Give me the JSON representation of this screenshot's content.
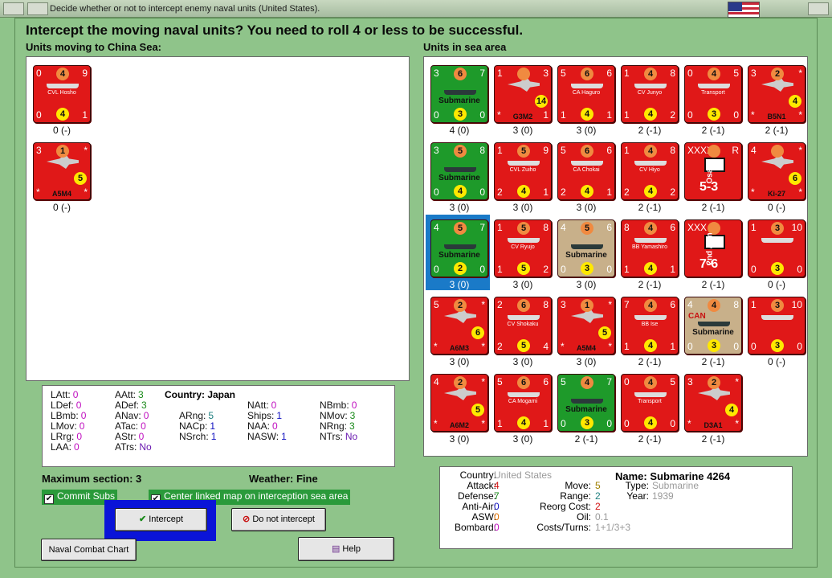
{
  "window": {
    "title": "Decide whether or not to intercept enemy naval units (United States)."
  },
  "header": {
    "title": "Intercept the moving naval units?  You need to roll 4 or less to be successful."
  },
  "left_panel": {
    "label": "Units moving to China Sea:",
    "units": [
      {
        "name": "CVL Hosho",
        "tl": "0",
        "tr": "9",
        "bl": "0",
        "br": "1",
        "top_val": "4",
        "bot_val": "4",
        "status": "0 (-)",
        "color": "red",
        "kind": "ship"
      },
      {
        "name": "A5M4",
        "tl": "3",
        "tr": "*",
        "bl": "*",
        "br": "*",
        "top_val": "1",
        "bot_val": "5",
        "status": "0 (-)",
        "color": "red",
        "kind": "plane"
      }
    ]
  },
  "right_panel": {
    "label": "Units in sea area",
    "units": [
      {
        "name": "Submarine",
        "tl": "3",
        "tr": "7",
        "bl": "0",
        "br": "0",
        "top_val": "6",
        "bot_val": "3",
        "status": "4 (0)",
        "color": "green",
        "kind": "sub"
      },
      {
        "name": "G3M2",
        "tl": "1",
        "tr": "3",
        "bl": "*",
        "br": "1",
        "top_val": "",
        "bot_val": "14",
        "status": "3 (0)",
        "color": "red",
        "kind": "plane"
      },
      {
        "name": "CA Haguro",
        "tl": "5",
        "tr": "6",
        "bl": "1",
        "br": "1",
        "top_val": "6",
        "bot_val": "4",
        "status": "3 (0)",
        "color": "red",
        "kind": "ship"
      },
      {
        "name": "CV Junyo",
        "tl": "1",
        "tr": "8",
        "bl": "1",
        "br": "2",
        "top_val": "4",
        "bot_val": "4",
        "status": "2 (-1)",
        "color": "red",
        "kind": "ship"
      },
      {
        "name": "Transport",
        "tl": "0",
        "tr": "5",
        "bl": "0",
        "br": "0",
        "top_val": "4",
        "bot_val": "3",
        "status": "2 (-1)",
        "color": "red",
        "kind": "ship"
      },
      {
        "name": "B5N1",
        "tl": "3",
        "tr": "*",
        "bl": "*",
        "br": "*",
        "top_val": "2",
        "bot_val": "4",
        "status": "2 (-1)",
        "color": "red",
        "kind": "plane"
      },
      {
        "name": "Submarine",
        "tl": "3",
        "tr": "8",
        "bl": "0",
        "br": "0",
        "top_val": "5",
        "bot_val": "4",
        "status": "3 (0)",
        "color": "green",
        "kind": "sub"
      },
      {
        "name": "CVL Zuiho",
        "tl": "1",
        "tr": "9",
        "bl": "2",
        "br": "1",
        "top_val": "5",
        "bot_val": "4",
        "status": "3 (0)",
        "color": "red",
        "kind": "ship"
      },
      {
        "name": "CA Chokai",
        "tl": "5",
        "tr": "6",
        "bl": "2",
        "br": "1",
        "top_val": "6",
        "bot_val": "4",
        "status": "3 (0)",
        "color": "red",
        "kind": "ship"
      },
      {
        "name": "CV Hiyo",
        "tl": "1",
        "tr": "8",
        "bl": "2",
        "br": "2",
        "top_val": "4",
        "bot_val": "4",
        "status": "2 (-1)",
        "color": "red",
        "kind": "ship"
      },
      {
        "name": "Osaka",
        "tl": "XXXX",
        "tr": "R",
        "bl": "",
        "br": "",
        "top_val": "",
        "bot_val": "5-3",
        "status": "2 (-1)",
        "color": "red",
        "kind": "land"
      },
      {
        "name": "Ki-27",
        "tl": "4",
        "tr": "*",
        "bl": "*",
        "br": "*",
        "top_val": "",
        "bot_val": "6",
        "status": "0 (-)",
        "color": "red",
        "kind": "plane"
      },
      {
        "name": "Submarine",
        "tl": "4",
        "tr": "7",
        "bl": "0",
        "br": "0",
        "top_val": "5",
        "bot_val": "2",
        "status": "3 (0)",
        "color": "green",
        "kind": "sub"
      },
      {
        "name": "CV Ryujo",
        "tl": "1",
        "tr": "8",
        "bl": "1",
        "br": "2",
        "top_val": "5",
        "bot_val": "5",
        "status": "3 (0)",
        "color": "red",
        "kind": "ship"
      },
      {
        "name": "Submarine",
        "tl": "4",
        "tr": "6",
        "bl": "0",
        "br": "0",
        "top_val": "5",
        "bot_val": "3",
        "status": "3 (0)",
        "color": "tan",
        "kind": "sub"
      },
      {
        "name": "BB Yamashiro",
        "tl": "8",
        "tr": "6",
        "bl": "1",
        "br": "1",
        "top_val": "4",
        "bot_val": "4",
        "status": "2 (-1)",
        "color": "red",
        "kind": "ship"
      },
      {
        "name": "2nd Arm",
        "tl": "XXX",
        "tr": "",
        "bl": "",
        "br": "",
        "top_val": "",
        "bot_val": "7-6",
        "status": "2 (-1)",
        "color": "red",
        "kind": "land"
      },
      {
        "name": "",
        "tl": "1",
        "tr": "10",
        "bl": "0",
        "br": "0",
        "top_val": "3",
        "bot_val": "3",
        "status": "0 (-)",
        "color": "red",
        "kind": "ship"
      },
      {
        "name": "A6M3",
        "tl": "5",
        "tr": "*",
        "bl": "*",
        "br": "*",
        "top_val": "2",
        "bot_val": "6",
        "status": "3 (0)",
        "color": "red",
        "kind": "plane"
      },
      {
        "name": "CV Shokaku",
        "tl": "2",
        "tr": "8",
        "bl": "2",
        "br": "4",
        "top_val": "6",
        "bot_val": "5",
        "status": "3 (0)",
        "color": "red",
        "kind": "ship"
      },
      {
        "name": "A5M4",
        "tl": "3",
        "tr": "*",
        "bl": "*",
        "br": "*",
        "top_val": "1",
        "bot_val": "5",
        "status": "3 (0)",
        "color": "red",
        "kind": "plane"
      },
      {
        "name": "BB Ise",
        "tl": "7",
        "tr": "6",
        "bl": "1",
        "br": "1",
        "top_val": "4",
        "bot_val": "4",
        "status": "2 (-1)",
        "color": "red",
        "kind": "ship"
      },
      {
        "name": "Submarine",
        "tl": "4",
        "tr": "8",
        "bl": "0",
        "br": "0",
        "top_val": "4",
        "bot_val": "3",
        "status": "2 (-1)",
        "color": "tan",
        "kind": "sub",
        "tag": "CAN"
      },
      {
        "name": "",
        "tl": "1",
        "tr": "10",
        "bl": "0",
        "br": "0",
        "top_val": "3",
        "bot_val": "3",
        "status": "0 (-)",
        "color": "red",
        "kind": "ship"
      },
      {
        "name": "A6M2",
        "tl": "4",
        "tr": "*",
        "bl": "*",
        "br": "*",
        "top_val": "2",
        "bot_val": "5",
        "status": "3 (0)",
        "color": "red",
        "kind": "plane"
      },
      {
        "name": "CA Mogami",
        "tl": "5",
        "tr": "6",
        "bl": "1",
        "br": "1",
        "top_val": "6",
        "bot_val": "4",
        "status": "3 (0)",
        "color": "red",
        "kind": "ship"
      },
      {
        "name": "Submarine",
        "tl": "5",
        "tr": "7",
        "bl": "0",
        "br": "0",
        "top_val": "4",
        "bot_val": "3",
        "status": "2 (-1)",
        "color": "green",
        "kind": "sub"
      },
      {
        "name": "Transport",
        "tl": "0",
        "tr": "5",
        "bl": "0",
        "br": "0",
        "top_val": "4",
        "bot_val": "4",
        "status": "2 (-1)",
        "color": "red",
        "kind": "ship"
      },
      {
        "name": "D3A1",
        "tl": "3",
        "tr": "*",
        "bl": "*",
        "br": "*",
        "top_val": "2",
        "bot_val": "4",
        "status": "2 (-1)",
        "color": "red",
        "kind": "plane"
      }
    ]
  },
  "stats": {
    "col1": [
      [
        "LAtt:",
        "0"
      ],
      [
        "LDef:",
        "0"
      ],
      [
        "LBmb:",
        "0"
      ],
      [
        "LMov:",
        "0"
      ],
      [
        "LRrg:",
        "0"
      ],
      [
        "LAA:",
        "0"
      ]
    ],
    "col2": [
      [
        "AAtt:",
        "3"
      ],
      [
        "ADef:",
        "3"
      ],
      [
        "ANav:",
        "0"
      ],
      [
        "ATac:",
        "0"
      ],
      [
        "AStr:",
        "0"
      ],
      [
        "ATrs:",
        "No"
      ]
    ],
    "country_label": "Country: Japan",
    "col3": [
      [
        "ARng:",
        "5"
      ],
      [
        "NACp:",
        "1"
      ],
      [
        "NSrch:",
        "1"
      ]
    ],
    "col4": [
      [
        "NAtt:",
        "0"
      ],
      [
        "Ships:",
        "1"
      ],
      [
        "NAA:",
        "0"
      ],
      [
        "NASW:",
        "1"
      ]
    ],
    "col5": [
      [
        "NBmb:",
        "0"
      ],
      [
        "NMov:",
        "3"
      ],
      [
        "NRng:",
        "3"
      ],
      [
        "NTrs:",
        "No"
      ]
    ]
  },
  "bottom": {
    "max_section": "Maximum section: 3",
    "weather": "Weather:  Fine",
    "commit_subs": "Commit Subs",
    "center_map": "Center linked map on interception sea area",
    "intercept_button": "Intercept",
    "no_intercept_button": "Do not intercept",
    "chart_button": "Naval Combat Chart",
    "help_button": "Help"
  },
  "detail": {
    "country_k": "Country:",
    "country_v": "United States",
    "attack_k": "Attack:",
    "attack_v": "4",
    "defense_k": "Defense:",
    "defense_v": "7",
    "aa_k": "Anti-Air:",
    "aa_v": "0",
    "asw_k": "ASW:",
    "asw_v": "0",
    "bomb_k": "Bombard:",
    "bomb_v": "0",
    "move_k": "Move:",
    "move_v": "5",
    "range_k": "Range:",
    "range_v": "2",
    "reorg_k": "Reorg Cost:",
    "reorg_v": "2",
    "oil_k": "Oil:",
    "oil_v": "0.1",
    "costs_k": "Costs/Turns:",
    "costs_v": "1+1/3+3",
    "name": "Name: Submarine 4264",
    "type_k": "Type:",
    "type_v": "Submarine",
    "year_k": "Year:",
    "year_v": "1939"
  }
}
